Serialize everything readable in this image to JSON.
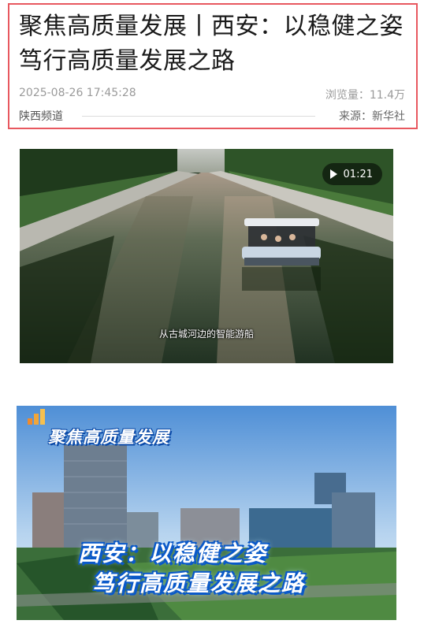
{
  "article": {
    "title": "聚焦高质量发展丨西安：以稳健之姿  笃行高质量发展之路",
    "date": "2025-08-26 17:45:28",
    "views": "浏览量：11.4万",
    "channel": "陕西频道",
    "source": "来源：新华社"
  },
  "video": {
    "duration": "01:21",
    "caption": "从古城河边的智能游船",
    "icon": "play-icon"
  },
  "poster": {
    "tag": "聚焦高质量发展",
    "line1": "西安：以稳健之姿",
    "line2": "笃行高质量发展之路"
  },
  "colors": {
    "border_accent": "#e8585f",
    "poster_blue": "#0a59c9"
  }
}
